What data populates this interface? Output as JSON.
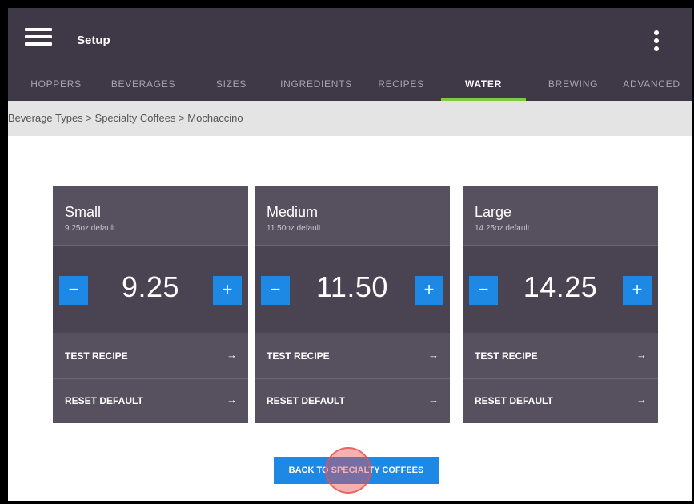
{
  "header": {
    "title": "Setup"
  },
  "tabs": [
    {
      "label": "HOPPERS",
      "active": false
    },
    {
      "label": "BEVERAGES",
      "active": false
    },
    {
      "label": "SIZES",
      "active": false
    },
    {
      "label": "INGREDIENTS",
      "active": false
    },
    {
      "label": "RECIPES",
      "active": false
    },
    {
      "label": "WATER",
      "active": true
    },
    {
      "label": "BREWING",
      "active": false
    },
    {
      "label": "ADVANCED",
      "active": false
    }
  ],
  "breadcrumb": "Beverage Types > Specialty Coffees > Mochaccino",
  "cards": [
    {
      "name": "Small",
      "default": "9.25oz default",
      "value": "9.25",
      "minus": "−",
      "plus": "+",
      "test": "TEST RECIPE",
      "reset": "RESET DEFAULT",
      "arrow": "→"
    },
    {
      "name": "Medium",
      "default": "11.50oz default",
      "value": "11.50",
      "minus": "−",
      "plus": "+",
      "test": "TEST RECIPE",
      "reset": "RESET DEFAULT",
      "arrow": "→"
    },
    {
      "name": "Large",
      "default": "14.25oz default",
      "value": "14.25",
      "minus": "−",
      "plus": "+",
      "test": "TEST RECIPE",
      "reset": "RESET DEFAULT",
      "arrow": "→"
    }
  ],
  "back_button": "BACK TO SPECIALTY COFFEES",
  "colors": {
    "appbar": "#3f3846",
    "card": "#57505f",
    "accent": "#1e88e5",
    "active_tab": "#7ccb43",
    "touch": "#e85050"
  }
}
